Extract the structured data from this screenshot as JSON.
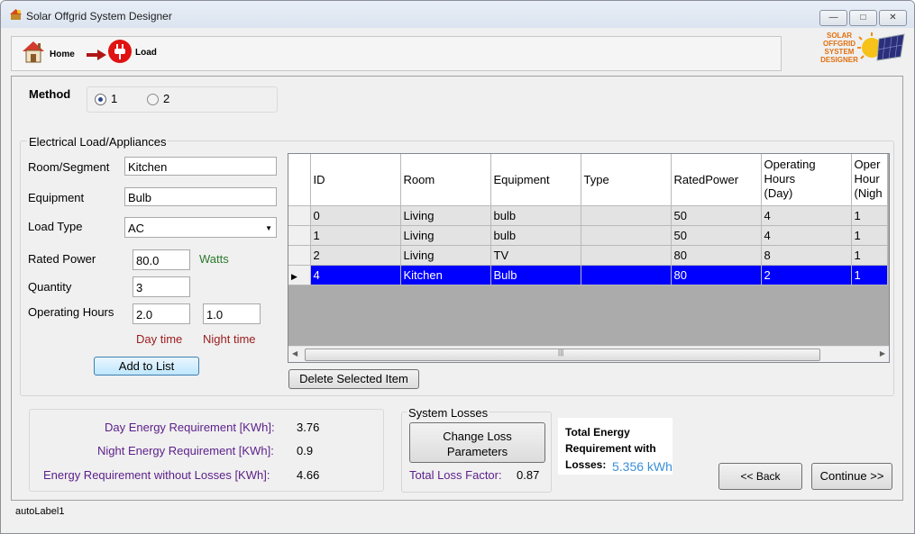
{
  "window": {
    "title": "Solar Offgrid System Designer"
  },
  "nav": {
    "home_label": "Home",
    "load_label": "Load"
  },
  "logo": {
    "line1": "SOLAR",
    "line2": "OFFGRID",
    "line3": "SYSTEM",
    "line4": "DESIGNER"
  },
  "method": {
    "label": "Method",
    "options": [
      "1",
      "2"
    ],
    "selected": "1"
  },
  "appliances": {
    "group_title": "Electrical Load/Appliances",
    "room_label": "Room/Segment",
    "room_value": "Kitchen",
    "equipment_label": "Equipment",
    "equipment_value": "Bulb",
    "loadtype_label": "Load Type",
    "loadtype_value": "AC",
    "rated_label": "Rated Power",
    "rated_value": "80.0",
    "rated_unit": "Watts",
    "quantity_label": "Quantity",
    "quantity_value": "3",
    "hours_label": "Operating Hours",
    "day_value": "2.0",
    "night_value": "1.0",
    "day_caption": "Day time",
    "night_caption": "Night time",
    "add_button": "Add to List"
  },
  "grid": {
    "headers": [
      "ID",
      "Room",
      "Equipment",
      "Type",
      "RatedPower",
      "Operating\nHours\n(Day)",
      "Oper\nHour\n(Nigh"
    ],
    "rows": [
      [
        "0",
        "Living",
        "bulb",
        "",
        "50",
        "4",
        "1"
      ],
      [
        "1",
        "Living",
        "bulb",
        "",
        "50",
        "4",
        "1"
      ],
      [
        "2",
        "Living",
        "TV",
        "",
        "80",
        "8",
        "1"
      ],
      [
        "4",
        "Kitchen",
        "Bulb",
        "",
        "80",
        "2",
        "1"
      ]
    ],
    "selected_row": 3,
    "delete_button": "Delete Selected Item"
  },
  "summary": {
    "day_label": "Day Energy Requirement [KWh]:",
    "day_value": "3.76",
    "night_label": "Night Energy Requirement [KWh]:",
    "night_value": "0.9",
    "total_label": "Energy Requirement without Losses [KWh]:",
    "total_value": "4.66"
  },
  "losses": {
    "group_title": "System Losses",
    "button_line1": "Change Loss",
    "button_line2": "Parameters",
    "factor_label": "Total Loss Factor:",
    "factor_value": "0.87"
  },
  "total": {
    "line1": "Total Energy",
    "line2": "Requirement with",
    "line3": "Losses:",
    "value": "5.356 kWh"
  },
  "buttons": {
    "back": "<< Back",
    "continue": "Continue >>"
  },
  "status": {
    "text": "autoLabel1"
  },
  "colors": {
    "selection": "#0000ff",
    "purple": "#5b1e8a",
    "darkred": "#9a1b1b",
    "green": "#2d7a2d",
    "blue_value": "#3a8fd8"
  }
}
